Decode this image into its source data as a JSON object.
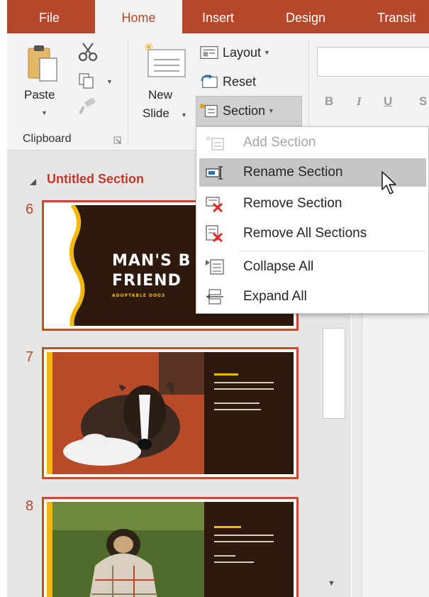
{
  "tabs": [
    {
      "label": "File"
    },
    {
      "label": "Home"
    },
    {
      "label": "Insert"
    },
    {
      "label": "Design"
    },
    {
      "label": "Transit"
    }
  ],
  "ribbon": {
    "paste_label": "Paste",
    "new_slide_line1": "New",
    "new_slide_line2": "Slide",
    "layout_label": "Layout",
    "reset_label": "Reset",
    "section_label": "Section",
    "clipboard_label": "Clipboard",
    "bold": "B",
    "italic": "I",
    "underline": "U",
    "strike": "S"
  },
  "pane": {
    "section_title": "Untitled Section",
    "slides": [
      {
        "number": "6",
        "title_line1": "MAN'S B",
        "title_line2": "FRIEND",
        "subtitle": "ADOPTABLE DOGS"
      },
      {
        "number": "7"
      },
      {
        "number": "8"
      }
    ]
  },
  "menu": {
    "items": [
      {
        "label": "Add Section",
        "icon": "add-section-icon",
        "enabled": false
      },
      {
        "label": "Rename Section",
        "icon": "rename-section-icon",
        "enabled": true
      },
      {
        "label": "Remove Section",
        "icon": "remove-section-icon",
        "enabled": true
      },
      {
        "label": "Remove All Sections",
        "icon": "remove-all-sections-icon",
        "enabled": true
      },
      {
        "label": "Collapse All",
        "icon": "collapse-all-icon",
        "enabled": true
      },
      {
        "label": "Expand All",
        "icon": "expand-all-icon",
        "enabled": true
      }
    ]
  },
  "colors": {
    "accent": "#b7472a",
    "section_title": "#c0392b",
    "thumb_border": "#c94b2a",
    "slide_dark": "#2d1a0c",
    "slide_yellow": "#f5b800",
    "menu_hover": "#c6c6c6"
  }
}
